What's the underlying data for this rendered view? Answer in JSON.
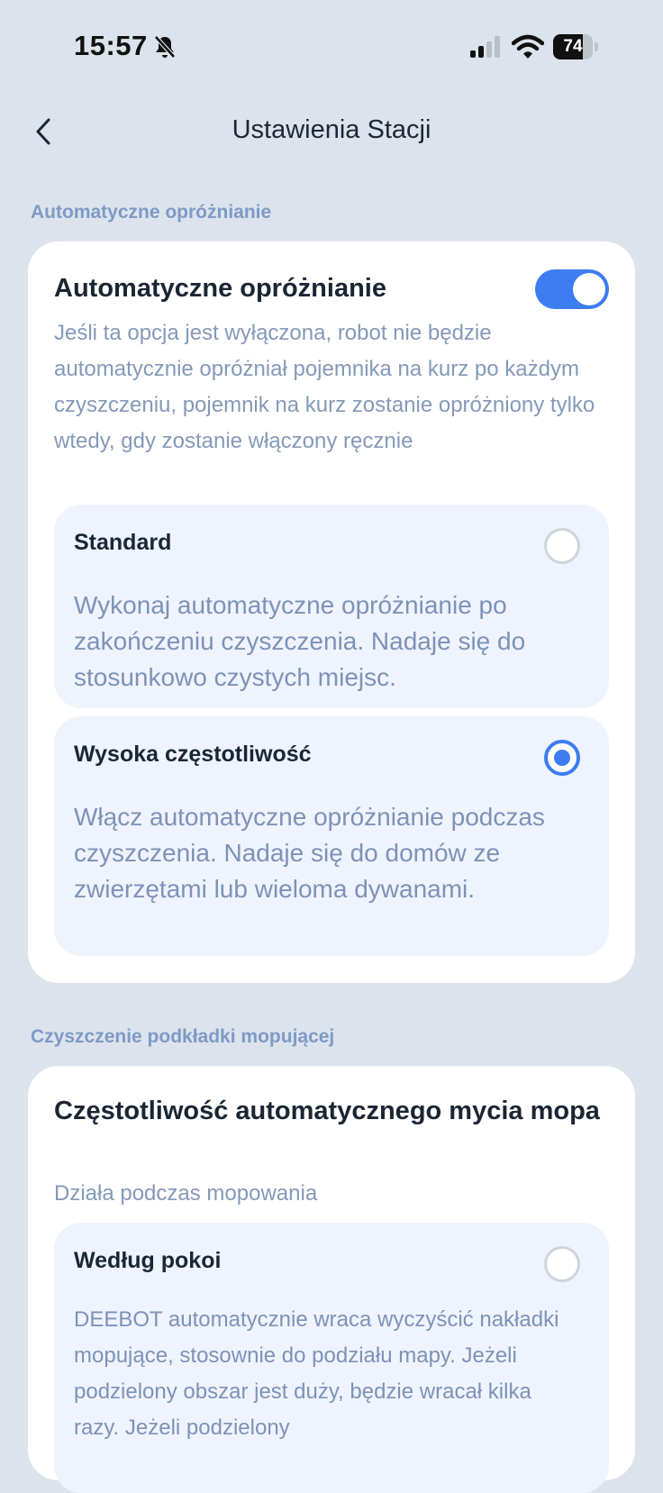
{
  "status": {
    "time": "15:57",
    "battery": "74",
    "battery_level": 0.74
  },
  "header": {
    "title": "Ustawienia Stacji"
  },
  "section1": {
    "label": "Automatyczne opróżnianie",
    "card_title": "Automatyczne opróżnianie",
    "toggle_on": true,
    "description": "Jeśli ta opcja jest wyłączona, robot nie będzie automatycznie opróżniał pojemnika na kurz po każdym czyszczeniu, pojemnik na kurz zostanie opróżniony tylko wtedy, gdy zostanie włączony ręcznie",
    "options": [
      {
        "title": "Standard",
        "description": "Wykonaj automatyczne opróżnianie po zakończeniu czyszczenia. Nadaje się do stosunkowo czystych miejsc.",
        "selected": false
      },
      {
        "title": "Wysoka częstotliwość",
        "description": "Włącz automatyczne opróżnianie podczas czyszczenia. Nadaje się do domów ze zwierzętami lub wieloma dywanami.",
        "selected": true
      }
    ]
  },
  "section2": {
    "label": "Czyszczenie podkładki mopującej",
    "card_title": "Częstotliwość automatycznego mycia mopa",
    "subtitle": "Działa podczas mopowania",
    "options": [
      {
        "title": "Według pokoi",
        "description": "DEEBOT automatycznie wraca wyczyścić nakładki mopujące, stosownie do podziału mapy. Jeżeli podzielony obszar jest duży, będzie wracał kilka razy. Jeżeli podzielony",
        "selected": false
      }
    ]
  },
  "colors": {
    "accent": "#3d7df2",
    "background": "#dde3ec",
    "option_bg": "#eef3fd"
  }
}
